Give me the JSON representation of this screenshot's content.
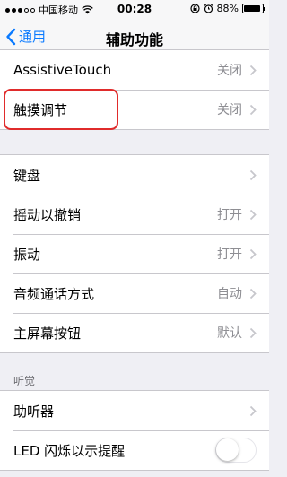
{
  "status_bar": {
    "carrier": "中国移动",
    "time": "00:28",
    "battery": "88%",
    "battery_level": 0.88,
    "icons": [
      "signal-dots",
      "wifi-icon",
      "lock-rotation-icon",
      "alarm-icon",
      "battery-icon"
    ]
  },
  "nav": {
    "back_label": "通用",
    "title": "辅助功能"
  },
  "group1": [
    {
      "label": "AssistiveTouch",
      "value": "关闭"
    },
    {
      "label": "触摸调节",
      "value": "关闭"
    }
  ],
  "group2": [
    {
      "label": "键盘",
      "value": ""
    },
    {
      "label": "摇动以撤销",
      "value": "打开"
    },
    {
      "label": "振动",
      "value": "打开"
    },
    {
      "label": "音频通话方式",
      "value": "自动"
    },
    {
      "label": "主屏幕按钮",
      "value": "默认"
    }
  ],
  "hearing": {
    "header": "听觉",
    "items": [
      {
        "label": "助听器"
      },
      {
        "label": "LED 闪烁以示提醒",
        "toggle": false
      }
    ]
  },
  "colors": {
    "accent": "#0a7aff",
    "highlight": "#e02b2b",
    "background": "#efeff4"
  }
}
